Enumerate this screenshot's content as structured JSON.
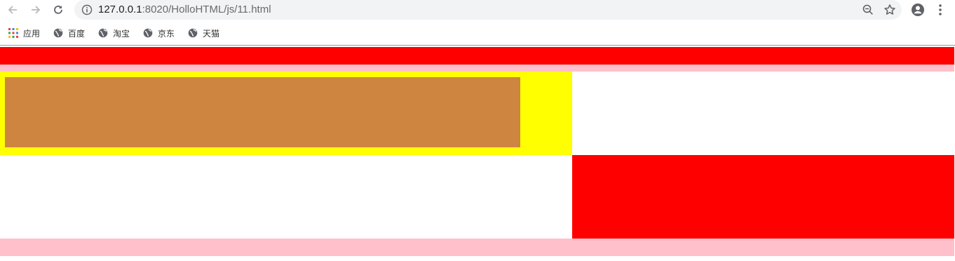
{
  "browser": {
    "url_host": "127.0.0.1",
    "url_path": ":8020/HolloHTML/js/11.html",
    "icons": {
      "back": "back-arrow-icon",
      "forward": "forward-arrow-icon",
      "reload": "reload-icon",
      "info": "info-icon",
      "zoom": "zoom-out-icon",
      "bookmark": "star-icon",
      "profile": "account-icon",
      "menu": "kebab-menu-icon"
    }
  },
  "bookmarks": {
    "apps_label": "应用",
    "items": [
      {
        "label": "百度"
      },
      {
        "label": "淘宝"
      },
      {
        "label": "京东"
      },
      {
        "label": "天猫"
      }
    ]
  },
  "page": {
    "colors": {
      "red": "#ff0000",
      "pink": "#ffc0cb",
      "yellow": "#ffff00",
      "brown": "#cd853f",
      "white": "#ffffff"
    }
  }
}
